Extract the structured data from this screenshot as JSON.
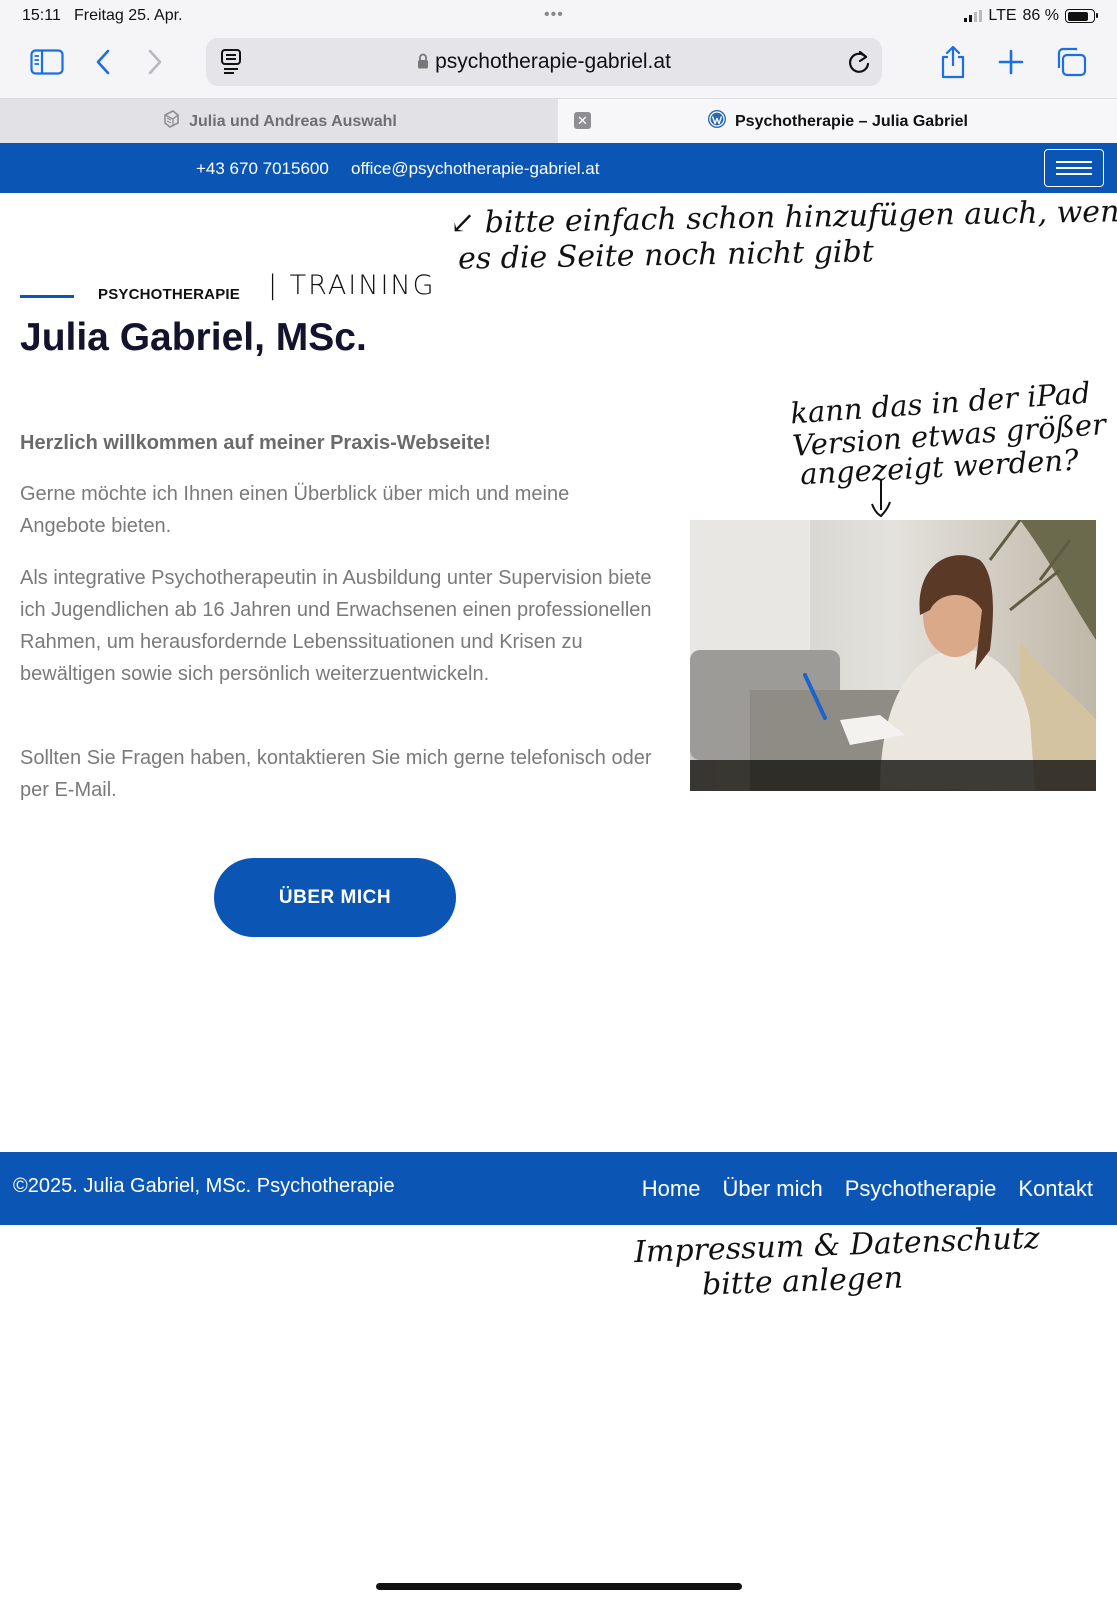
{
  "status_bar": {
    "time": "15:11",
    "date": "Freitag 25. Apr.",
    "dots": "•••",
    "network": "LTE",
    "battery": "86 %",
    "battery_level": 0.86
  },
  "browser": {
    "url": "psychotherapie-gabriel.at",
    "tabs": [
      {
        "title": "Julia und Andreas Auswahl",
        "active": false
      },
      {
        "title": "Psychotherapie – Julia Gabriel",
        "active": true
      }
    ],
    "tab_close_glyph": "✕"
  },
  "site": {
    "brand_color": "#0b56b5",
    "topbar": {
      "phone": "+43 670 7015600",
      "email": "office@psychotherapie-gabriel.at"
    },
    "eyebrow": "PSYCHOTHERAPIE",
    "heading": "Julia Gabriel, MSc.",
    "welcome": "Herzlich willkommen auf meiner Praxis-Webseite!",
    "paragraphs": [
      "Gerne möchte ich Ihnen einen Überblick über mich und meine Angebote bieten.",
      "Als integrative Psychotherapeutin in Ausbildung unter Supervision biete ich Jugendlichen ab 16 Jahren und Erwachsenen einen professionellen Rahmen, um herausfordernde Lebenssituationen und Krisen zu bewältigen sowie sich persönlich weiterzuentwickeln.",
      "Sollten Sie Fragen haben, kontaktieren Sie mich gerne telefonisch oder per E-Mail."
    ],
    "cta_label": "ÜBER MICH",
    "footer": {
      "copyright": "©2025. Julia Gabriel, MSc. Psychotherapie",
      "nav": [
        "Home",
        "Über mich",
        "Psychotherapie",
        "Kontakt"
      ]
    }
  },
  "handwritten_notes": {
    "training": "| TRAINING",
    "top_line1": "↙ bitte einfach schon hinzufügen auch, wenn",
    "top_line2": "es die Seite noch nicht gibt",
    "ipad_line1": "kann das in der iPad",
    "ipad_line2": "Version etwas größer",
    "ipad_line3": "angezeigt werden?",
    "impressum_line1": "Impressum & Datenschutz",
    "impressum_line2": "bitte anlegen"
  }
}
